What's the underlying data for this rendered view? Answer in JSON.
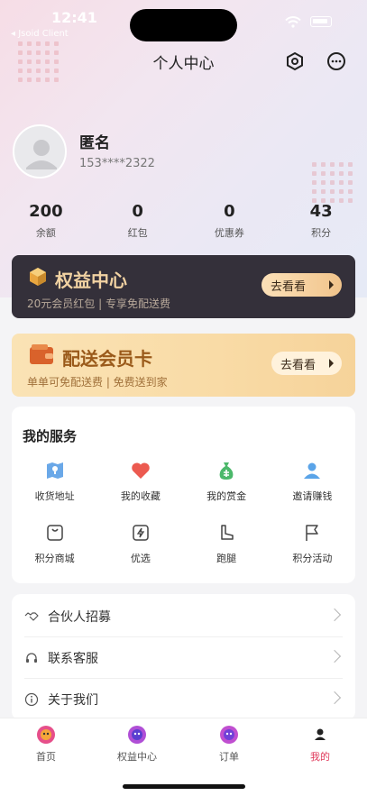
{
  "status_bar": {
    "time": "12:41",
    "back_app": "◂ Jsoid Client"
  },
  "nav": {
    "title": "个人中心"
  },
  "profile": {
    "name": "匿名",
    "phone": "153****2322"
  },
  "stats": [
    {
      "value": "200",
      "label": "余额"
    },
    {
      "value": "0",
      "label": "红包"
    },
    {
      "value": "0",
      "label": "优惠券"
    },
    {
      "value": "43",
      "label": "积分"
    }
  ],
  "benefits_card": {
    "title": "权益中心",
    "subtitle": "20元会员红包 | 专享免配送费",
    "button": "去看看"
  },
  "delivery_card": {
    "title": "配送会员卡",
    "subtitle": "单单可免配送费 | 免费送到家",
    "button": "去看看"
  },
  "services": {
    "title": "我的服务",
    "items": [
      {
        "label": "收货地址",
        "icon": "map-icon"
      },
      {
        "label": "我的收藏",
        "icon": "heart-icon"
      },
      {
        "label": "我的赏金",
        "icon": "money-bag-icon"
      },
      {
        "label": "邀请赚钱",
        "icon": "person-icon"
      },
      {
        "label": "积分商城",
        "icon": "shopping-bag-icon"
      },
      {
        "label": "优选",
        "icon": "lightning-icon"
      },
      {
        "label": "跑腿",
        "icon": "boot-icon"
      },
      {
        "label": "积分活动",
        "icon": "flag-icon"
      }
    ]
  },
  "menu": [
    {
      "label": "合伙人招募",
      "icon": "handshake-icon"
    },
    {
      "label": "联系客服",
      "icon": "headset-icon"
    },
    {
      "label": "关于我们",
      "icon": "info-icon"
    }
  ],
  "tabbar": [
    {
      "label": "首页",
      "icon": "home-icon",
      "active": false
    },
    {
      "label": "权益中心",
      "icon": "benefits-icon",
      "active": false
    },
    {
      "label": "订单",
      "icon": "order-icon",
      "active": false
    },
    {
      "label": "我的",
      "icon": "profile-icon",
      "active": true
    }
  ],
  "colors": {
    "accent_active": "#e0395a",
    "card_dark": "#34303a",
    "card_gold": "#f9dba6",
    "gold_text": "#f1d2a2"
  }
}
